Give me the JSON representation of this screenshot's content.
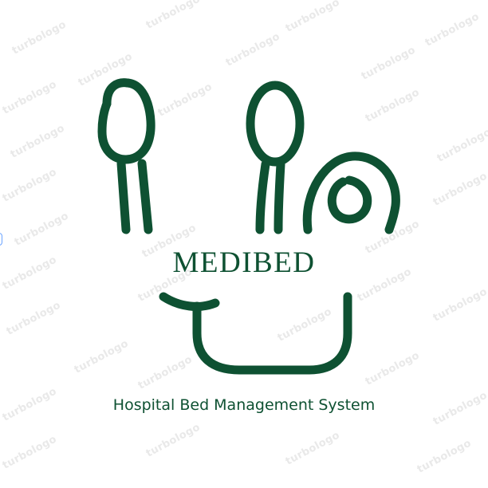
{
  "logo": {
    "brand_name": "MEDIBED",
    "tagline": "Hospital Bed Management System",
    "icon_name": "stethoscope-bed-icon",
    "color": "#0e5132"
  },
  "watermark": {
    "text": "turbologo"
  }
}
